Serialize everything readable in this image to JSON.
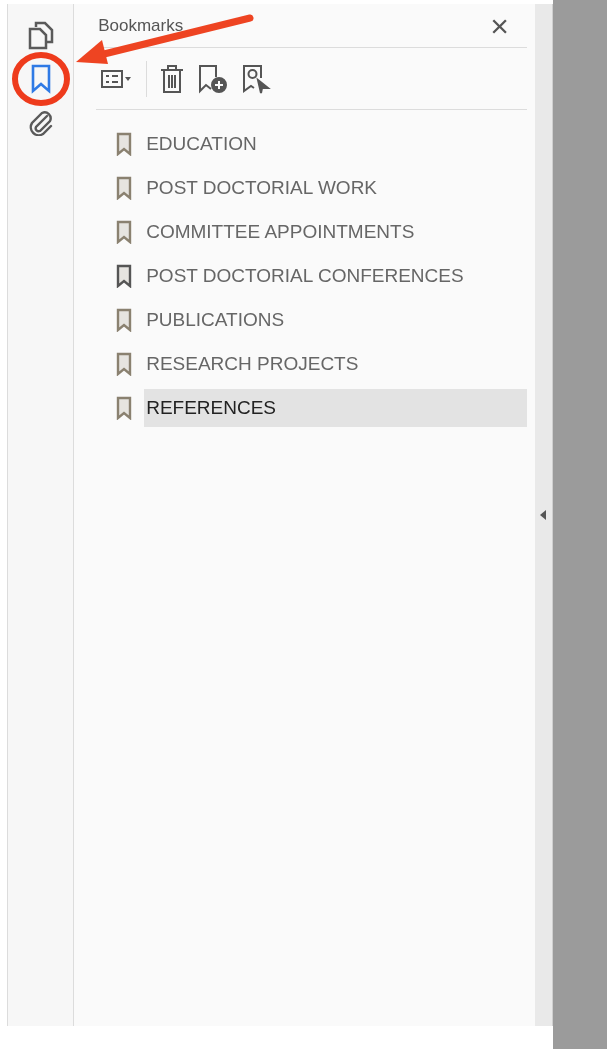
{
  "rail": [
    {
      "kind": "pages",
      "selected": false
    },
    {
      "kind": "bookmarks",
      "selected": true,
      "circled": true
    },
    {
      "kind": "attachments",
      "selected": false
    }
  ],
  "panel": {
    "title": "Bookmarks",
    "close": "×"
  },
  "toolbar": [
    {
      "kind": "options"
    },
    {
      "kind": "delete"
    },
    {
      "kind": "new"
    },
    {
      "kind": "find"
    }
  ],
  "bookmarks_list": [
    {
      "label": "EDUCATION",
      "selected": false,
      "icon_dark": false
    },
    {
      "label": "POST DOCTORIAL WORK",
      "selected": false,
      "icon_dark": false
    },
    {
      "label": "COMMITTEE APPOINTMENTS",
      "selected": false,
      "icon_dark": false
    },
    {
      "label": "POST DOCTORIAL CONFERENCES",
      "selected": false,
      "icon_dark": true
    },
    {
      "label": "PUBLICATIONS",
      "selected": false,
      "icon_dark": false
    },
    {
      "label": "RESEARCH PROJECTS",
      "selected": false,
      "icon_dark": false
    },
    {
      "label": "REFERENCES",
      "selected": true,
      "icon_dark": false
    }
  ]
}
